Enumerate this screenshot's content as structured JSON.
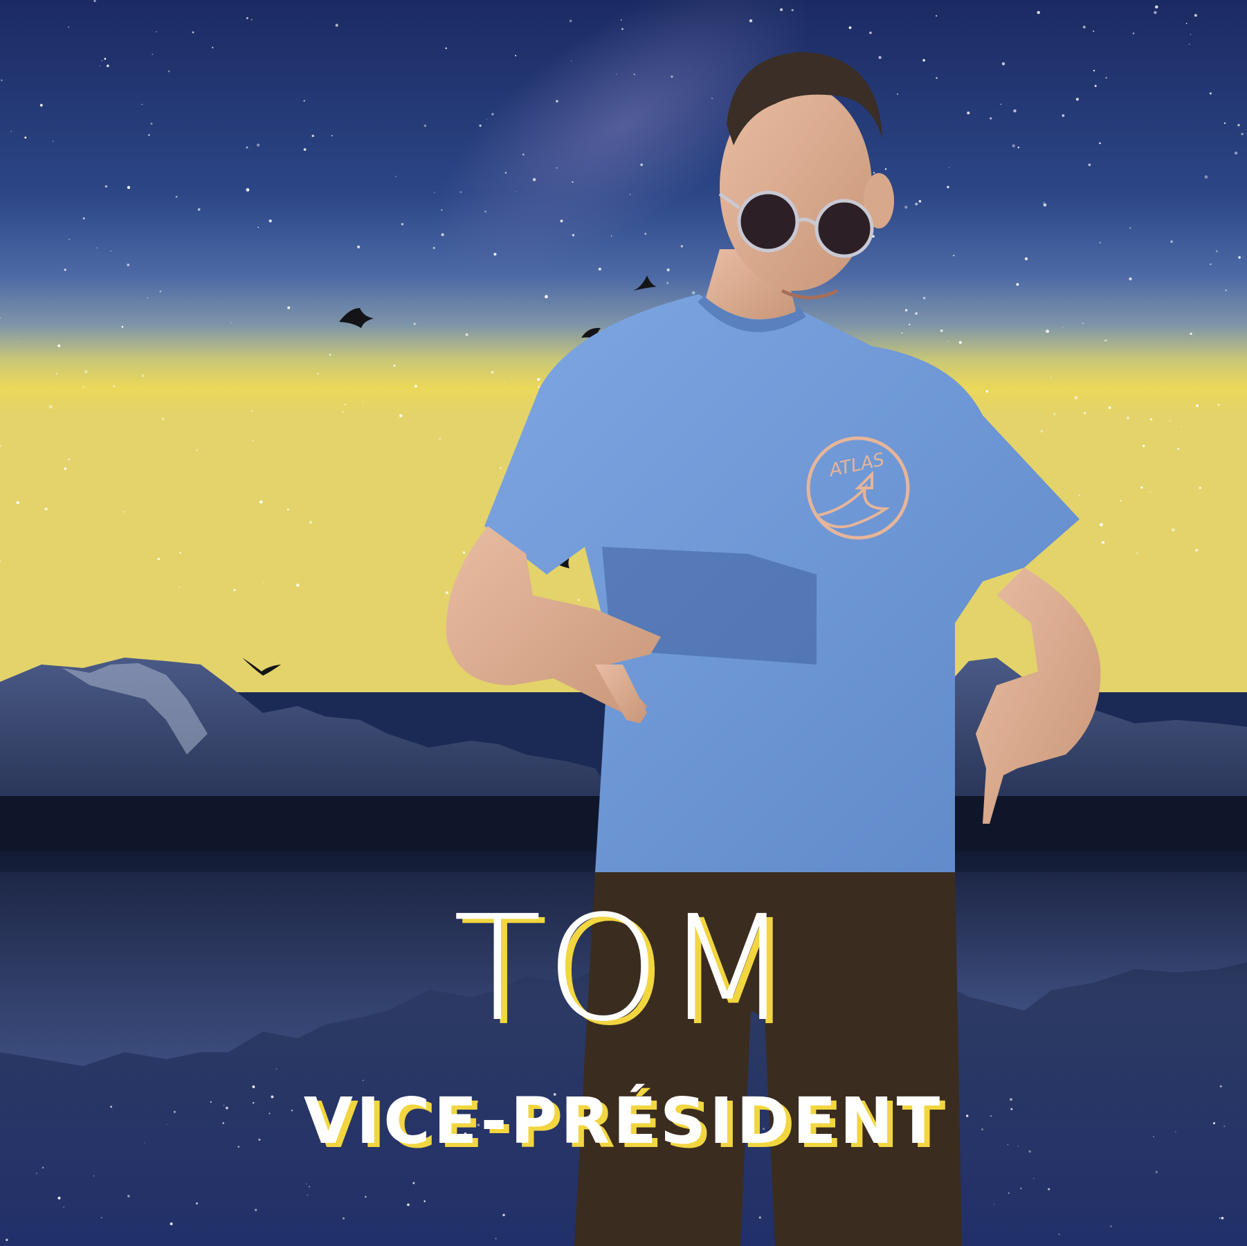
{
  "card": {
    "name": "TOM",
    "role": "VICE-PRÉSIDENT",
    "shirt_logo_text": "ATLAS"
  },
  "scene": {
    "background": "starry night sky over mountains reflected in a lake",
    "person": "young man in sunglasses and a light blue t-shirt pointing down with both hands",
    "birds": 5
  },
  "colors": {
    "accent_yellow": "#f2d640",
    "text_white": "#ffffff",
    "sky_top": "#1d2c63",
    "sky_mid": "#4a6aa8",
    "horizon_glow": "#e8d560",
    "shirt_blue": "#6f9ad8",
    "pants_brown": "#3a2a1e"
  }
}
